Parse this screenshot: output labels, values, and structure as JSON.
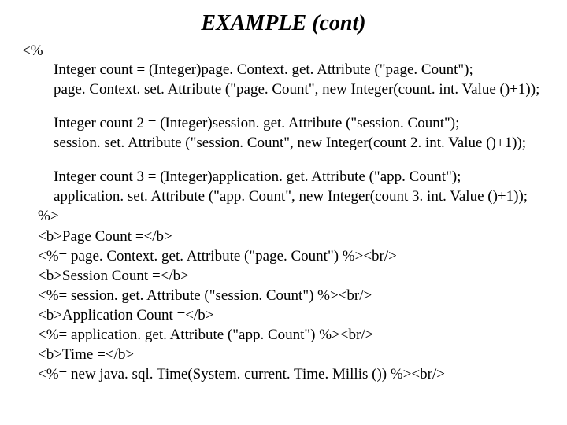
{
  "title": "EXAMPLE (cont)",
  "open_tag": "<%",
  "block1": {
    "l1": "Integer count = (Integer)page. Context. get. Attribute (\"page. Count\");",
    "l2": "page. Context. set. Attribute (\"page. Count\", new Integer(count. int. Value ()+1));"
  },
  "block2": {
    "l1": "Integer count 2 = (Integer)session. get. Attribute (\"session. Count\");",
    "l2": "session. set. Attribute (\"session. Count\", new Integer(count 2. int. Value ()+1));"
  },
  "block3": {
    "l1": "Integer count 3 = (Integer)application. get. Attribute (\"app. Count\");",
    "l2": "application. set. Attribute (\"app. Count\", new Integer(count 3. int. Value ()+1));"
  },
  "tail": {
    "l1": "%>",
    "l2": "<b>Page Count =</b>",
    "l3": "<%= page. Context. get. Attribute (\"page. Count\") %><br/>",
    "l4": "<b>Session Count =</b>",
    "l5": "<%= session. get. Attribute (\"session. Count\") %><br/>",
    "l6": "<b>Application Count =</b>",
    "l7": "<%= application. get. Attribute (\"app. Count\") %><br/>",
    "l8": "<b>Time =</b>",
    "l9": "<%= new java. sql. Time(System. current. Time. Millis ()) %><br/>"
  }
}
